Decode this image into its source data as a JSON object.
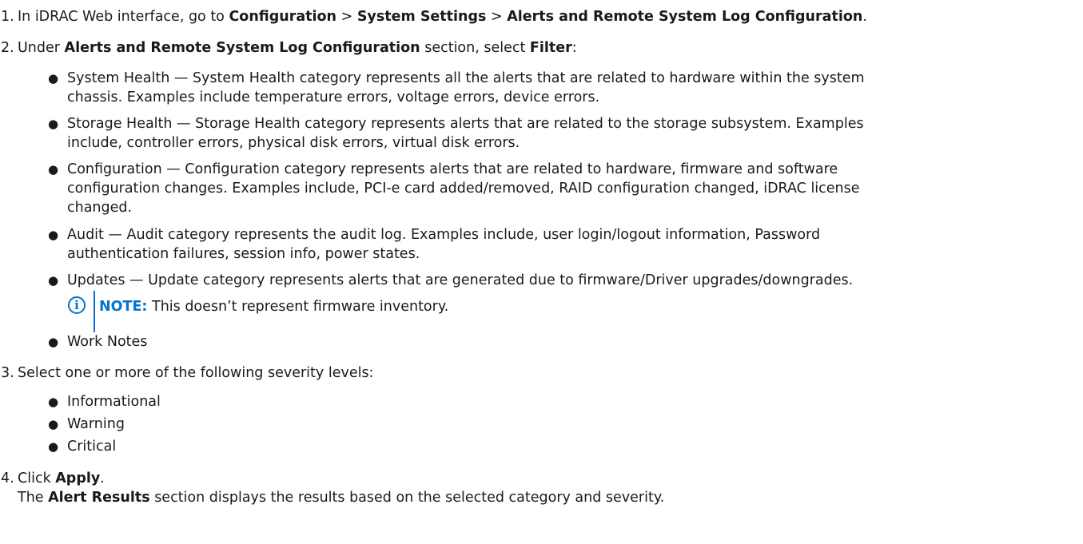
{
  "steps": [
    {
      "num": "1.",
      "pre": "In iDRAC Web interface, go to ",
      "b1": "Configuration",
      "sep1": " > ",
      "b2": "System Settings",
      "sep2": " > ",
      "b3": "Alerts and Remote System Log Configuration",
      "post": "."
    },
    {
      "num": "2.",
      "pre": "Under ",
      "b1": "Alerts and Remote System Log Configuration",
      "mid": " section, select ",
      "b2": "Filter",
      "post": ":"
    },
    {
      "num": "3.",
      "text": "Select one or more of the following severity levels:"
    },
    {
      "num": "4.",
      "pre": "Click ",
      "b1": "Apply",
      "post": ".",
      "line2_pre": "The ",
      "line2_b": "Alert Results",
      "line2_post": " section displays the results based on the selected category and severity."
    }
  ],
  "categories": [
    {
      "line1": "System Health — System Health category represents all the alerts that are related to hardware within the system",
      "line2": "chassis. Examples include temperature errors, voltage errors, device errors."
    },
    {
      "line1": "Storage Health — Storage Health category represents alerts that are related to the storage subsystem. Examples",
      "line2": "include, controller errors, physical disk errors, virtual disk errors."
    },
    {
      "line1": "Configuration — Configuration category represents alerts that are related to hardware, firmware and software",
      "line2": "configuration changes. Examples include, PCI-e card added/removed, RAID configuration changed, iDRAC license",
      "line3": "changed."
    },
    {
      "line1": "Audit — Audit category represents the audit log. Examples include, user login/logout information, Password",
      "line2": "authentication failures, session info, power states."
    },
    {
      "line1": "Updates — Update category represents alerts that are generated due to firmware/Driver upgrades/downgrades."
    },
    {
      "line1": "Work Notes"
    }
  ],
  "note": {
    "icon": "i",
    "label": "NOTE:",
    "text": "This doesn’t represent firmware inventory."
  },
  "severities": [
    "Informational",
    "Warning",
    "Critical"
  ],
  "bullet_char": "●"
}
